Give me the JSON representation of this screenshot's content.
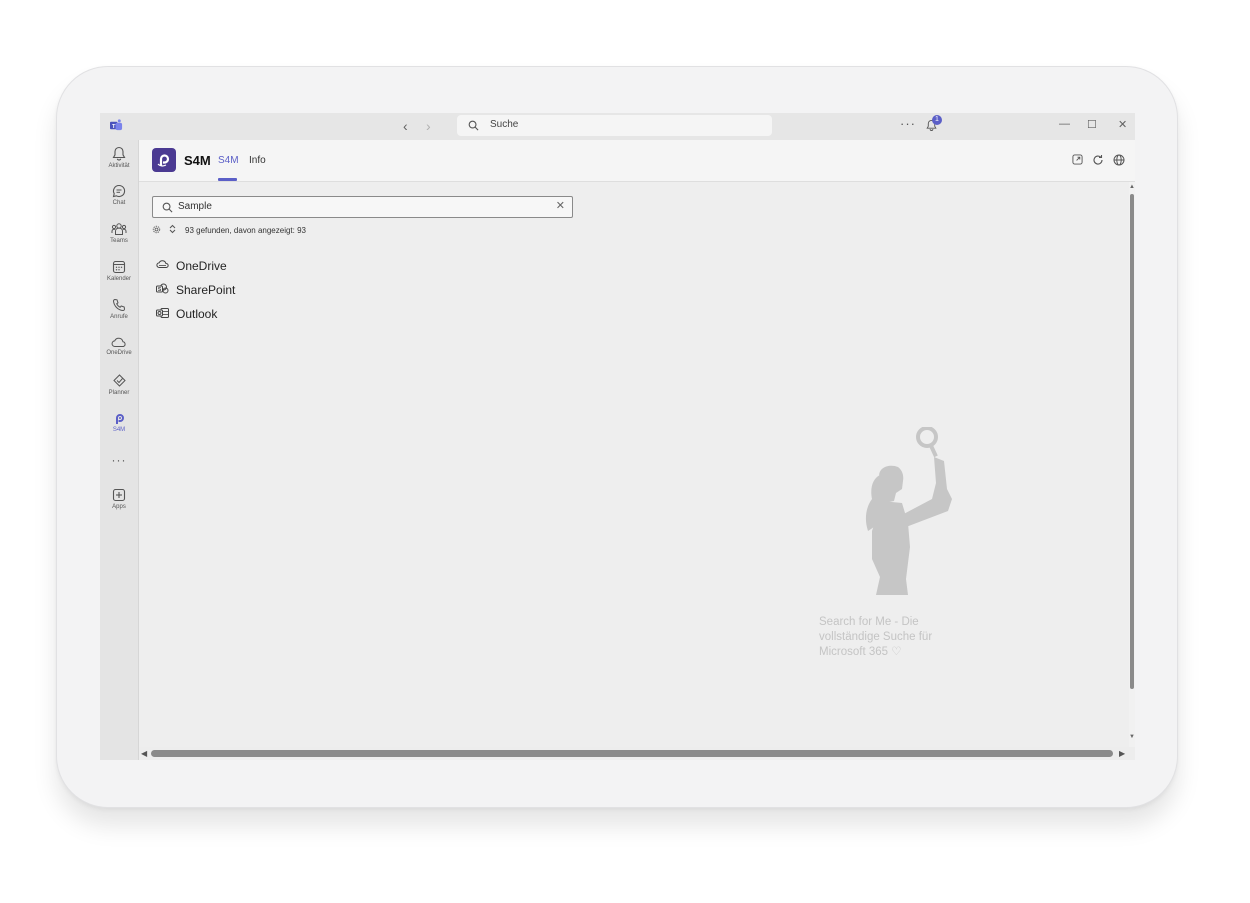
{
  "titlebar": {
    "back_icon": "chevron-left-icon",
    "forward_icon": "chevron-right-icon",
    "search_placeholder": "Suche",
    "more": "···",
    "notification_count": "1",
    "minimize": "—",
    "maximize": "☐",
    "close": "✕"
  },
  "rail": {
    "items": [
      {
        "label": "Aktivität",
        "icon": "bell-icon"
      },
      {
        "label": "Chat",
        "icon": "chat-icon"
      },
      {
        "label": "Teams",
        "icon": "teams-icon"
      },
      {
        "label": "Kalender",
        "icon": "calendar-icon"
      },
      {
        "label": "Anrufe",
        "icon": "phone-icon"
      },
      {
        "label": "OneDrive",
        "icon": "cloud-icon"
      },
      {
        "label": "Planner",
        "icon": "planner-icon"
      },
      {
        "label": "S4M",
        "icon": "s4m-icon"
      }
    ],
    "more": "···",
    "apps_label": "Apps"
  },
  "app": {
    "title": "S4M",
    "tabs": [
      "S4M",
      "Info"
    ],
    "active_tab": "S4M",
    "accent_color": "#5b5fc7"
  },
  "search": {
    "value": "Sample",
    "clear": "✕"
  },
  "results": {
    "count_text": "93 gefunden, davon angezeigt: 93"
  },
  "sources": [
    {
      "label": "OneDrive",
      "icon": "onedrive-icon"
    },
    {
      "label": "SharePoint",
      "icon": "sharepoint-icon"
    },
    {
      "label": "Outlook",
      "icon": "outlook-icon"
    }
  ],
  "tagline": "Search for Me - Die vollständige Suche für Microsoft 365 ♡"
}
